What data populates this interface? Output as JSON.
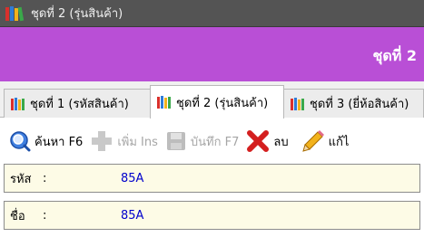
{
  "window": {
    "title": "ชุดที่ 2 (รุ่นสินค้า)"
  },
  "header": {
    "title": "ชุดที่ 2"
  },
  "tabs": [
    {
      "label": "ชุดที่ 1 (รหัสสินค้า)",
      "active": false
    },
    {
      "label": "ชุดที่ 2 (รุ่นสินค้า)",
      "active": true
    },
    {
      "label": "ชุดที่ 3 (ยี่ห้อสินค้า)",
      "active": false
    }
  ],
  "toolbar": {
    "search_label": "ค้นหา F6",
    "add_label": "เพิ่ม Ins",
    "save_label": "บันทึก F7",
    "delete_label": "ลบ",
    "edit_label": "แก้ไ"
  },
  "fields": {
    "code": {
      "label": "รหัส",
      "separator": ":",
      "value": "85A"
    },
    "name": {
      "label": "ชื่อ",
      "separator": ":",
      "value": "85A"
    }
  },
  "colors": {
    "titlebar": "#545454",
    "header": "#b94fd6",
    "field_bg": "#fdfbe6",
    "value_text": "#0000cc"
  }
}
